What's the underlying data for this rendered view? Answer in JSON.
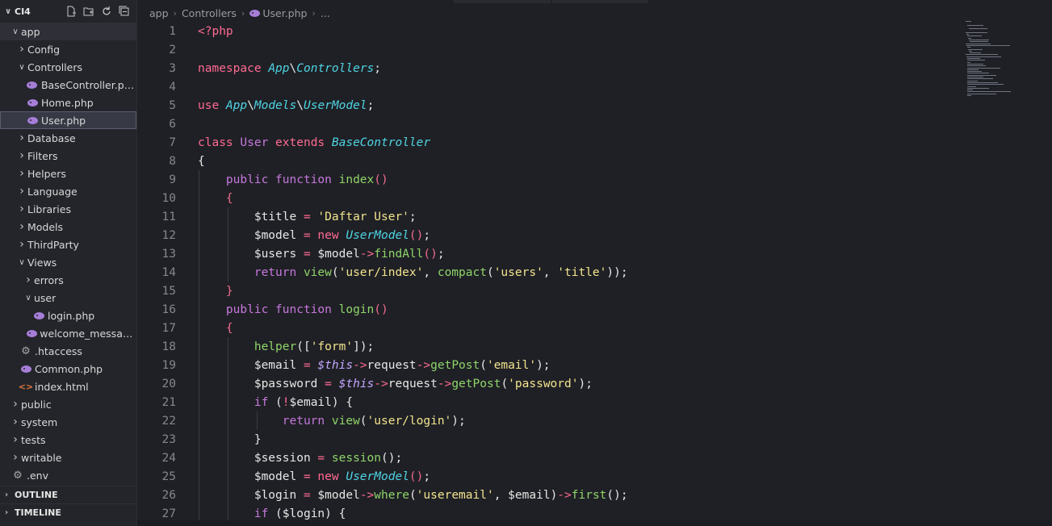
{
  "explorer": {
    "root_label": "CI4",
    "tree": [
      {
        "label": "app",
        "depth": 0,
        "type": "folder-open",
        "state": "parent-active"
      },
      {
        "label": "Config",
        "depth": 1,
        "type": "folder"
      },
      {
        "label": "Controllers",
        "depth": 1,
        "type": "folder-open"
      },
      {
        "label": "BaseController.php",
        "depth": 2,
        "type": "php"
      },
      {
        "label": "Home.php",
        "depth": 2,
        "type": "php"
      },
      {
        "label": "User.php",
        "depth": 2,
        "type": "php",
        "state": "active"
      },
      {
        "label": "Database",
        "depth": 1,
        "type": "folder"
      },
      {
        "label": "Filters",
        "depth": 1,
        "type": "folder"
      },
      {
        "label": "Helpers",
        "depth": 1,
        "type": "folder"
      },
      {
        "label": "Language",
        "depth": 1,
        "type": "folder"
      },
      {
        "label": "Libraries",
        "depth": 1,
        "type": "folder"
      },
      {
        "label": "Models",
        "depth": 1,
        "type": "folder"
      },
      {
        "label": "ThirdParty",
        "depth": 1,
        "type": "folder"
      },
      {
        "label": "Views",
        "depth": 1,
        "type": "folder-open"
      },
      {
        "label": "errors",
        "depth": 2,
        "type": "folder"
      },
      {
        "label": "user",
        "depth": 2,
        "type": "folder-open"
      },
      {
        "label": "login.php",
        "depth": 3,
        "type": "php"
      },
      {
        "label": "welcome_message....",
        "depth": 2,
        "type": "php"
      },
      {
        "label": ".htaccess",
        "depth": 1,
        "type": "gear"
      },
      {
        "label": "Common.php",
        "depth": 1,
        "type": "php"
      },
      {
        "label": "index.html",
        "depth": 1,
        "type": "html"
      },
      {
        "label": "public",
        "depth": 0,
        "type": "folder"
      },
      {
        "label": "system",
        "depth": 0,
        "type": "folder"
      },
      {
        "label": "tests",
        "depth": 0,
        "type": "folder"
      },
      {
        "label": "writable",
        "depth": 0,
        "type": "folder"
      },
      {
        "label": ".env",
        "depth": 0,
        "type": "gear-root"
      }
    ],
    "outline_label": "OUTLINE",
    "timeline_label": "TIMELINE"
  },
  "breadcrumb": {
    "parts": [
      "app",
      "Controllers",
      "User.php",
      "..."
    ]
  },
  "code_lines": [
    [
      [
        "php-tag",
        "<?php"
      ]
    ],
    [],
    [
      [
        "kw2",
        "namespace "
      ],
      [
        "cls",
        "App"
      ],
      [
        "punc",
        "\\"
      ],
      [
        "cls",
        "Controllers"
      ],
      [
        "punc",
        ";"
      ]
    ],
    [],
    [
      [
        "kw2",
        "use "
      ],
      [
        "cls",
        "App"
      ],
      [
        "punc",
        "\\"
      ],
      [
        "cls",
        "Models"
      ],
      [
        "punc",
        "\\"
      ],
      [
        "cls",
        "UserModel"
      ],
      [
        "punc",
        ";"
      ]
    ],
    [],
    [
      [
        "kw2",
        "class "
      ],
      [
        "kw",
        "User "
      ],
      [
        "kw2",
        "extends "
      ],
      [
        "cls",
        "BaseController"
      ]
    ],
    [
      [
        "punc",
        "{"
      ]
    ],
    [
      [
        "punc",
        "    "
      ],
      [
        "kw",
        "public function "
      ],
      [
        "fn",
        "index"
      ],
      [
        "brace",
        "()"
      ]
    ],
    [
      [
        "punc",
        "    "
      ],
      [
        "brace",
        "{"
      ]
    ],
    [
      [
        "punc",
        "        "
      ],
      [
        "var",
        "$title "
      ],
      [
        "op",
        "= "
      ],
      [
        "str",
        "'Daftar User'"
      ],
      [
        "punc",
        ";"
      ]
    ],
    [
      [
        "punc",
        "        "
      ],
      [
        "var",
        "$model "
      ],
      [
        "op",
        "= "
      ],
      [
        "kw2",
        "new "
      ],
      [
        "cls",
        "UserModel"
      ],
      [
        "brace",
        "()"
      ],
      [
        "punc",
        ";"
      ]
    ],
    [
      [
        "punc",
        "        "
      ],
      [
        "var",
        "$users "
      ],
      [
        "op",
        "= "
      ],
      [
        "var",
        "$model"
      ],
      [
        "op",
        "->"
      ],
      [
        "fn",
        "findAll"
      ],
      [
        "brace",
        "()"
      ],
      [
        "punc",
        ";"
      ]
    ],
    [
      [
        "punc",
        "        "
      ],
      [
        "kw",
        "return "
      ],
      [
        "fn",
        "view"
      ],
      [
        "punc",
        "("
      ],
      [
        "str",
        "'user/index'"
      ],
      [
        "punc",
        ", "
      ],
      [
        "fn",
        "compact"
      ],
      [
        "punc",
        "("
      ],
      [
        "str",
        "'users'"
      ],
      [
        "punc",
        ", "
      ],
      [
        "str",
        "'title'"
      ],
      [
        "punc",
        "));"
      ]
    ],
    [
      [
        "punc",
        "    "
      ],
      [
        "brace",
        "}"
      ]
    ],
    [
      [
        "punc",
        "    "
      ],
      [
        "kw",
        "public function "
      ],
      [
        "fn",
        "login"
      ],
      [
        "brace",
        "()"
      ]
    ],
    [
      [
        "punc",
        "    "
      ],
      [
        "brace",
        "{"
      ]
    ],
    [
      [
        "punc",
        "        "
      ],
      [
        "fn",
        "helper"
      ],
      [
        "punc",
        "(["
      ],
      [
        "str",
        "'form'"
      ],
      [
        "punc",
        "]);"
      ]
    ],
    [
      [
        "punc",
        "        "
      ],
      [
        "var",
        "$email "
      ],
      [
        "op",
        "= "
      ],
      [
        "this",
        "$this"
      ],
      [
        "op",
        "->"
      ],
      [
        "var",
        "request"
      ],
      [
        "op",
        "->"
      ],
      [
        "fn",
        "getPost"
      ],
      [
        "punc",
        "("
      ],
      [
        "str",
        "'email'"
      ],
      [
        "punc",
        ");"
      ]
    ],
    [
      [
        "punc",
        "        "
      ],
      [
        "var",
        "$password "
      ],
      [
        "op",
        "= "
      ],
      [
        "this",
        "$this"
      ],
      [
        "op",
        "->"
      ],
      [
        "var",
        "request"
      ],
      [
        "op",
        "->"
      ],
      [
        "fn",
        "getPost"
      ],
      [
        "punc",
        "("
      ],
      [
        "str",
        "'password'"
      ],
      [
        "punc",
        ");"
      ]
    ],
    [
      [
        "punc",
        "        "
      ],
      [
        "kw",
        "if "
      ],
      [
        "punc",
        "("
      ],
      [
        "op",
        "!"
      ],
      [
        "var",
        "$email"
      ],
      [
        "punc",
        ") {"
      ]
    ],
    [
      [
        "punc",
        "            "
      ],
      [
        "kw",
        "return "
      ],
      [
        "fn",
        "view"
      ],
      [
        "punc",
        "("
      ],
      [
        "str",
        "'user/login'"
      ],
      [
        "punc",
        ");"
      ]
    ],
    [
      [
        "punc",
        "        }"
      ]
    ],
    [
      [
        "punc",
        "        "
      ],
      [
        "var",
        "$session "
      ],
      [
        "op",
        "= "
      ],
      [
        "fn",
        "session"
      ],
      [
        "punc",
        "();"
      ]
    ],
    [
      [
        "punc",
        "        "
      ],
      [
        "var",
        "$model "
      ],
      [
        "op",
        "= "
      ],
      [
        "kw2",
        "new "
      ],
      [
        "cls",
        "UserModel"
      ],
      [
        "brace",
        "()"
      ],
      [
        "punc",
        ";"
      ]
    ],
    [
      [
        "punc",
        "        "
      ],
      [
        "var",
        "$login "
      ],
      [
        "op",
        "= "
      ],
      [
        "var",
        "$model"
      ],
      [
        "op",
        "->"
      ],
      [
        "fn",
        "where"
      ],
      [
        "punc",
        "("
      ],
      [
        "str",
        "'useremail'"
      ],
      [
        "punc",
        ", "
      ],
      [
        "var",
        "$email"
      ],
      [
        "punc",
        ")"
      ],
      [
        "op",
        "->"
      ],
      [
        "fn",
        "first"
      ],
      [
        "punc",
        "();"
      ]
    ],
    [
      [
        "punc",
        "        "
      ],
      [
        "kw",
        "if "
      ],
      [
        "punc",
        "("
      ],
      [
        "var",
        "$login"
      ],
      [
        "punc",
        ") {"
      ]
    ]
  ],
  "colors": {
    "background": "#1f2025",
    "sidebar": "#24252b",
    "keyword": "#c678dd",
    "class": "#4fd4e4",
    "function": "#8fd46a",
    "string": "#f2e48f",
    "operator": "#ff6a92"
  }
}
